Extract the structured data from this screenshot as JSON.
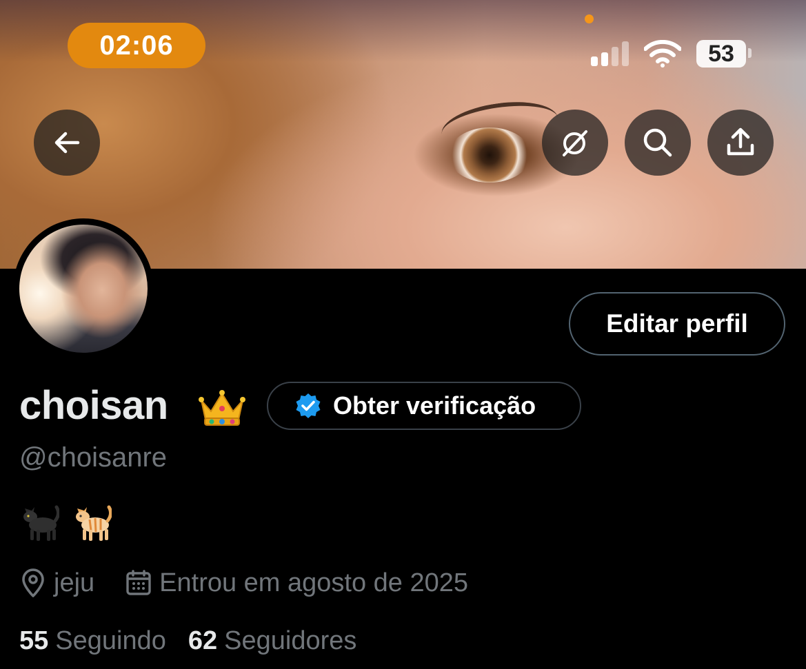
{
  "status_bar": {
    "time": "02:06",
    "battery": "53"
  },
  "header": {
    "back_icon": "arrow-left-icon",
    "actions": [
      {
        "icon": "grok-slash-icon"
      },
      {
        "icon": "search-icon"
      },
      {
        "icon": "share-upload-icon"
      }
    ]
  },
  "profile": {
    "edit_label": "Editar perfil",
    "display_name": "choisan",
    "name_emoji": "crown",
    "verify_label": "Obter verificação",
    "handle": "@choisanre",
    "bio_emojis": [
      "black-cat",
      "orange-cat"
    ],
    "location": "jeju",
    "joined": "Entrou em agosto de 2025",
    "following_count": "55",
    "following_label": "Seguindo",
    "followers_count": "62",
    "followers_label": "Seguidores"
  },
  "colors": {
    "accent_blue": "#1d9bf0",
    "time_pill": "#e3890f",
    "muted_text": "#71767b"
  }
}
